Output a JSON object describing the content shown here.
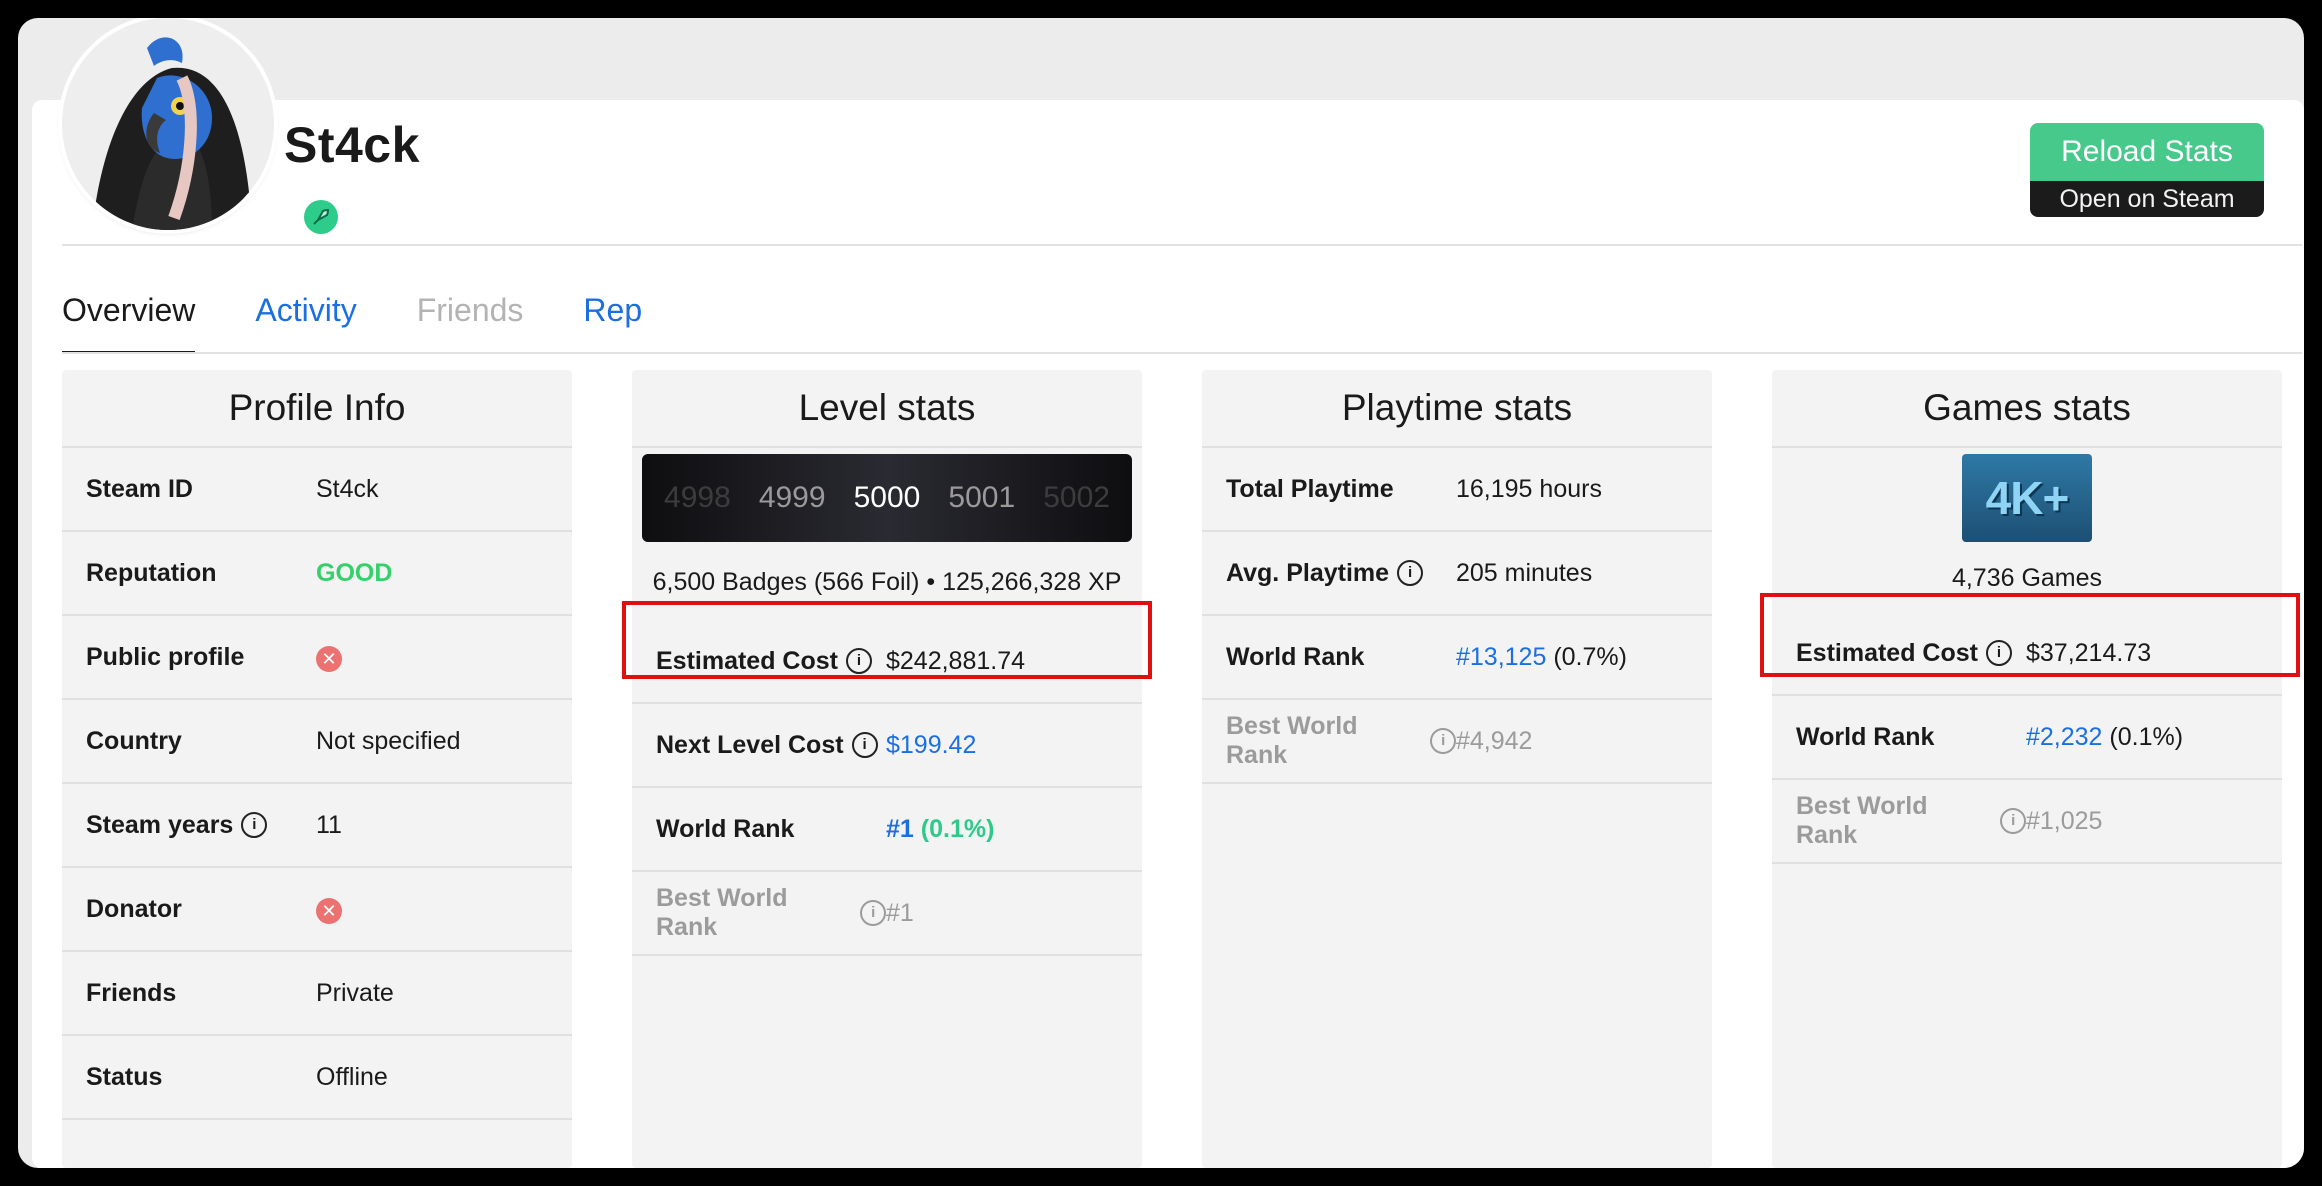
{
  "profile": {
    "name": "St4ck",
    "avatar_icon": "parrot-hood-avatar",
    "status_icon": "rocket-icon"
  },
  "actions": {
    "reload_label": "Reload Stats",
    "steam_label": "Open on Steam"
  },
  "tabs": [
    {
      "label": "Overview",
      "state": "active"
    },
    {
      "label": "Activity",
      "state": "link"
    },
    {
      "label": "Friends",
      "state": "disabled"
    },
    {
      "label": "Rep",
      "state": "link"
    }
  ],
  "profile_info": {
    "title": "Profile Info",
    "rows": [
      {
        "key": "Steam ID",
        "value": "St4ck"
      },
      {
        "key": "Reputation",
        "value": "GOOD"
      },
      {
        "key": "Public profile",
        "value": "✕"
      },
      {
        "key": "Country",
        "value": "Not specified"
      },
      {
        "key": "Steam years",
        "value": "11"
      },
      {
        "key": "Donator",
        "value": "✕"
      },
      {
        "key": "Friends",
        "value": "Private"
      },
      {
        "key": "Status",
        "value": "Offline"
      }
    ]
  },
  "level_stats": {
    "title": "Level stats",
    "badge_levels": [
      "4998",
      "4999",
      "5000",
      "5001",
      "5002"
    ],
    "badges_line": "6,500 Badges (566 Foil) • 125,266,328 XP",
    "rows": [
      {
        "key": "Estimated Cost",
        "value": "$242,881.74"
      },
      {
        "key": "Next Level Cost",
        "value": "$199.42"
      },
      {
        "key": "World Rank",
        "value": "#1",
        "extra": "(0.1%)"
      },
      {
        "key": "Best World Rank",
        "value": "#1"
      }
    ]
  },
  "playtime_stats": {
    "title": "Playtime stats",
    "rows": [
      {
        "key": "Total Playtime",
        "value": "16,195 hours"
      },
      {
        "key": "Avg. Playtime",
        "value": "205 minutes"
      },
      {
        "key": "World Rank",
        "value": "#13,125",
        "extra": "(0.7%)"
      },
      {
        "key": "Best World Rank",
        "value": "#4,942"
      }
    ]
  },
  "games_stats": {
    "title": "Games stats",
    "icon_text": "4K+",
    "games_count": "4,736 Games",
    "rows": [
      {
        "key": "Estimated Cost",
        "value": "$37,214.73"
      },
      {
        "key": "World Rank",
        "value": "#2,232",
        "extra": "(0.1%)"
      },
      {
        "key": "Best World Rank",
        "value": "#1,025"
      }
    ]
  },
  "colors": {
    "accent_green": "#46c98a",
    "link_blue": "#1c6fe0",
    "good_green": "#36d06a",
    "highlight_red": "#e01010"
  }
}
